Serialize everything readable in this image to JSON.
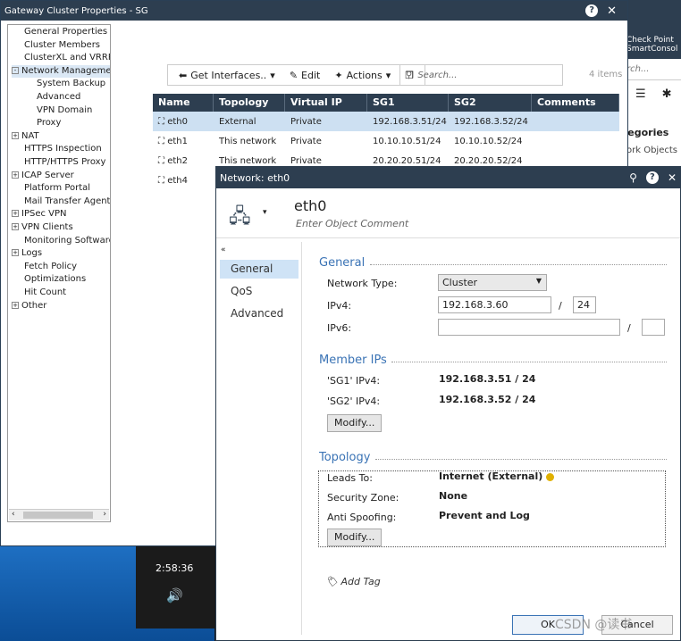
{
  "taskbar": {
    "time": "2:58:36"
  },
  "console": {
    "brand_line1": "Check Point",
    "brand_line2": "SmartConsol",
    "search_text": "rch...",
    "categories": "tegories",
    "objects": "ork Objects"
  },
  "main": {
    "title": "Gateway Cluster Properties - SG",
    "tree": [
      {
        "label": "General Properties",
        "indent": 0,
        "pm": ""
      },
      {
        "label": "Cluster Members",
        "indent": 0,
        "pm": ""
      },
      {
        "label": "ClusterXL and VRRP",
        "indent": 0,
        "pm": ""
      },
      {
        "label": "Network Management",
        "indent": 0,
        "pm": "-"
      },
      {
        "label": "System Backup",
        "indent": 1,
        "pm": ""
      },
      {
        "label": "Advanced",
        "indent": 1,
        "pm": ""
      },
      {
        "label": "VPN Domain",
        "indent": 1,
        "pm": ""
      },
      {
        "label": "Proxy",
        "indent": 1,
        "pm": ""
      },
      {
        "label": "NAT",
        "indent": 0,
        "pm": "+"
      },
      {
        "label": "HTTPS Inspection",
        "indent": 0,
        "pm": ""
      },
      {
        "label": "HTTP/HTTPS Proxy",
        "indent": 0,
        "pm": ""
      },
      {
        "label": "ICAP Server",
        "indent": 0,
        "pm": "+"
      },
      {
        "label": "Platform Portal",
        "indent": 0,
        "pm": ""
      },
      {
        "label": "Mail Transfer Agent",
        "indent": 0,
        "pm": ""
      },
      {
        "label": "IPSec VPN",
        "indent": 0,
        "pm": "+"
      },
      {
        "label": "VPN Clients",
        "indent": 0,
        "pm": "+"
      },
      {
        "label": "Monitoring Software b",
        "indent": 0,
        "pm": ""
      },
      {
        "label": "Logs",
        "indent": 0,
        "pm": "+"
      },
      {
        "label": "Fetch Policy",
        "indent": 0,
        "pm": ""
      },
      {
        "label": "Optimizations",
        "indent": 0,
        "pm": ""
      },
      {
        "label": "Hit Count",
        "indent": 0,
        "pm": ""
      },
      {
        "label": "Other",
        "indent": 0,
        "pm": "+"
      }
    ],
    "toolbar": {
      "get_interfaces": "Get Interfaces..",
      "edit": "Edit",
      "actions": "Actions",
      "search_placeholder": "Search...",
      "items_count": "4 items"
    },
    "grid": {
      "headers": [
        "Name",
        "Topology",
        "Virtual IP",
        "SG1",
        "SG2",
        "Comments"
      ],
      "rows": [
        [
          "eth0",
          "External",
          "Private",
          "192.168.3.51/24",
          "192.168.3.52/24",
          ""
        ],
        [
          "eth1",
          "This network",
          "Private",
          "10.10.10.51/24",
          "10.10.10.52/24",
          ""
        ],
        [
          "eth2",
          "This network",
          "Private",
          "20.20.20.51/24",
          "20.20.20.52/24",
          ""
        ],
        [
          "eth4",
          "",
          "",
          "",
          "",
          ""
        ]
      ]
    }
  },
  "dialog": {
    "title": "Network: eth0",
    "object_name": "eth0",
    "comment_placeholder": "Enter Object Comment",
    "nav": [
      "General",
      "QoS",
      "Advanced"
    ],
    "general": {
      "section": "General",
      "network_type_label": "Network Type:",
      "network_type_value": "Cluster",
      "ipv4_label": "IPv4:",
      "ipv4_value": "192.168.3.60",
      "ipv4_mask": "24",
      "ipv6_label": "IPv6:",
      "slash": "/"
    },
    "members": {
      "section": "Member IPs",
      "sg1_label": "'SG1' IPv4:",
      "sg1_value": "192.168.3.51 / 24",
      "sg2_label": "'SG2' IPv4:",
      "sg2_value": "192.168.3.52 / 24",
      "modify": "Modify..."
    },
    "topology": {
      "section": "Topology",
      "leads_label": "Leads To:",
      "leads_value": "Internet (External)",
      "zone_label": "Security Zone:",
      "zone_value": "None",
      "spoof_label": "Anti Spoofing:",
      "spoof_value": "Prevent and Log",
      "modify": "Modify..."
    },
    "add_tag": "Add Tag",
    "ok": "OK",
    "cancel": "Cancel",
    "watermark": "CSDN @读书"
  }
}
